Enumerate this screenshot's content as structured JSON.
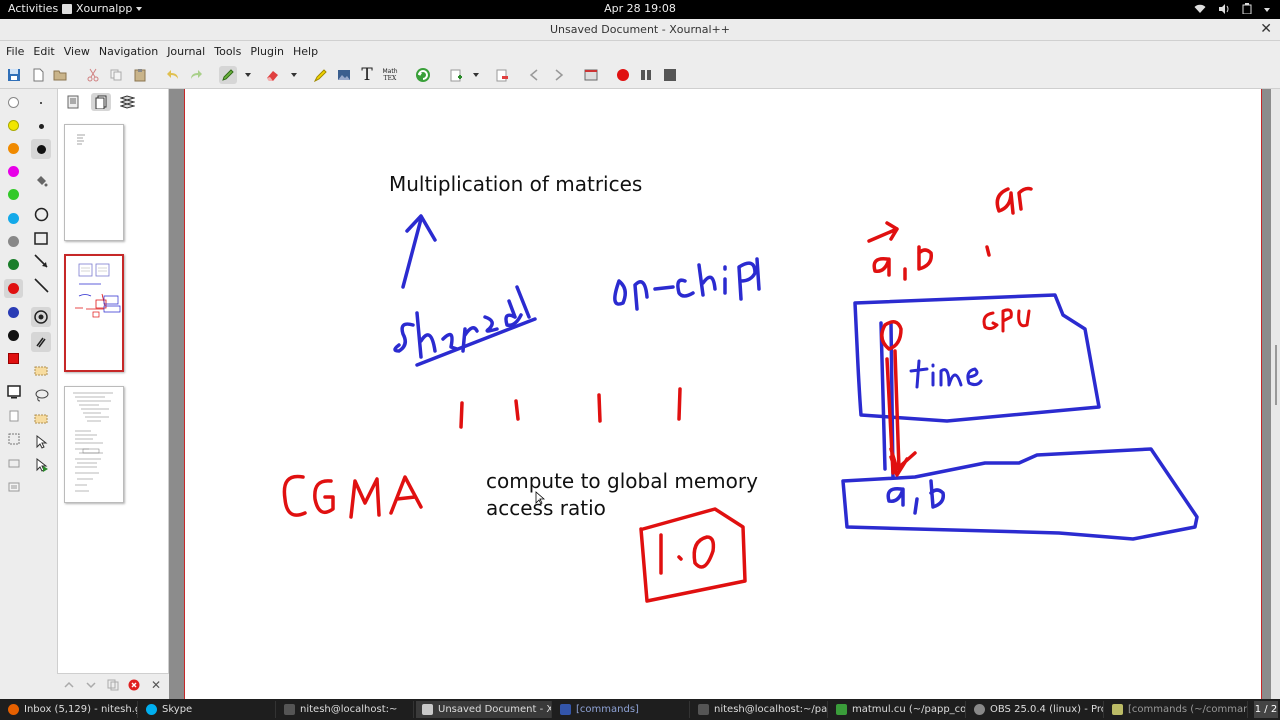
{
  "topbar": {
    "activities": "Activities",
    "app_name": "Xournalpp",
    "clock": "Apr 28  19:08"
  },
  "window": {
    "title": "Unsaved Document - Xournal++",
    "close": "✕"
  },
  "menu": [
    "File",
    "Edit",
    "View",
    "Navigation",
    "Journal",
    "Tools",
    "Plugin",
    "Help"
  ],
  "toolbar": {
    "text_tool": "T",
    "math_tex_line1": "Math",
    "math_tex_line2": "TEX"
  },
  "palette": {
    "colors": [
      "#ffffff",
      "#f2e600",
      "#f08a00",
      "#e800e8",
      "#33c92a",
      "#13a9e9",
      "#888888",
      "#1b7e2b",
      "#e01010",
      "#2a3cb5",
      "#111111"
    ],
    "current_color": "#e01010"
  },
  "sidebar": {
    "page_count": 3,
    "selected_page": 2
  },
  "document": {
    "heading": "Multiplication of matrices",
    "line1": "compute to global memory",
    "line2": "access ratio",
    "ink_colors": {
      "blue": "#2b2bd0",
      "red": "#e01010"
    }
  },
  "taskbar": {
    "items": [
      {
        "label": "Inbox (5,129) - nitesh.gu...",
        "icon_color": "#e66000"
      },
      {
        "label": "Skype",
        "icon_color": "#00aff0"
      },
      {
        "label": "nitesh@localhost:~",
        "icon_color": "#555555"
      },
      {
        "label": "Unsaved Document - Xo...",
        "icon_color": "#c9c9c9"
      },
      {
        "label": "[commands]",
        "icon_color": "#3355aa"
      },
      {
        "label": "nitesh@localhost:~/pap...",
        "icon_color": "#555555"
      },
      {
        "label": "matmul.cu (~/papp_cod...",
        "icon_color": "#3a9d3a"
      },
      {
        "label": "OBS 25.0.4 (linux) - Profi...",
        "icon_color": "#888888"
      },
      {
        "label": "[commands (~/comman...",
        "icon_color": "#bbbb66"
      }
    ],
    "pager": "1 / 2"
  }
}
